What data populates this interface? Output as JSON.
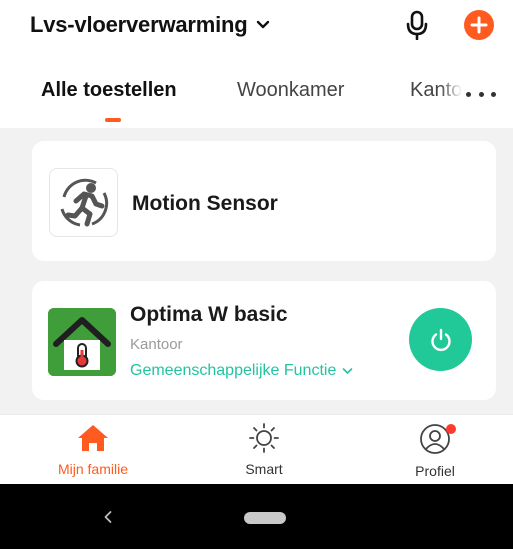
{
  "header": {
    "home_name": "Lvs-vloerverwarming",
    "icons": {
      "chevron": "chevron-down-icon",
      "mic": "microphone-icon",
      "add": "add-plus-icon"
    },
    "accent_color": "#ff5a1f"
  },
  "tabs": [
    {
      "label": "Alle toestellen",
      "active": true
    },
    {
      "label": "Woonkamer",
      "active": false
    },
    {
      "label": "Kantoor",
      "active": false
    }
  ],
  "devices": [
    {
      "name": "Motion Sensor",
      "icon": "motion-sensor-icon"
    },
    {
      "name": "Optima W basic",
      "room": "Kantoor",
      "function_label": "Gemeenschappelijke Functie",
      "icon": "thermostat-house-icon",
      "power_color": "#20c997"
    }
  ],
  "bottom_nav": [
    {
      "label": "Mijn familie",
      "icon": "home-icon",
      "active": true
    },
    {
      "label": "Smart",
      "icon": "sun-icon",
      "active": false
    },
    {
      "label": "Profiel",
      "icon": "profile-icon",
      "active": false,
      "notification_dot": true
    }
  ]
}
